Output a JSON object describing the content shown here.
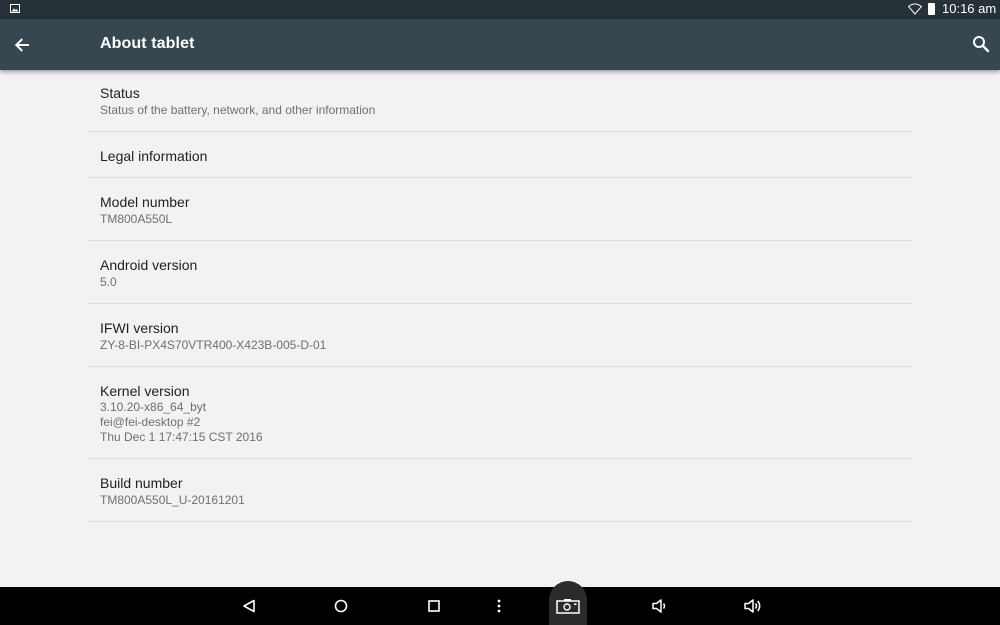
{
  "status_bar": {
    "time": "10:16 am",
    "icons": [
      "notification-image-icon",
      "wifi-icon",
      "battery-icon"
    ]
  },
  "app_bar": {
    "title": "About tablet",
    "back_icon": "arrow-back-icon",
    "search_icon": "search-icon"
  },
  "items": [
    {
      "label": "Status",
      "sub": "Status of the battery, network, and other information"
    },
    {
      "label": "Legal information",
      "sub": ""
    },
    {
      "label": "Model number",
      "sub": "TM800A550L"
    },
    {
      "label": "Android version",
      "sub": "5.0"
    },
    {
      "label": "IFWI version",
      "sub": "ZY-8-BI-PX4S70VTR400-X423B-005-D-01"
    },
    {
      "label": "Kernel version",
      "sub": "3.10.20-x86_64_byt\nfei@fei-desktop #2\nThu Dec 1 17:47:15 CST 2016"
    },
    {
      "label": "Build number",
      "sub": "TM800A550L_U-20161201"
    }
  ],
  "nav_bar": {
    "buttons": [
      "back-icon",
      "home-icon",
      "recents-icon",
      "menu-icon",
      "screenshot-icon",
      "volume-down-icon",
      "volume-up-icon"
    ]
  },
  "colors": {
    "status_bar": "#263238",
    "app_bar": "#37474f",
    "background": "#f2f2f2",
    "divider": "#dedede",
    "nav_bar": "#000000"
  }
}
